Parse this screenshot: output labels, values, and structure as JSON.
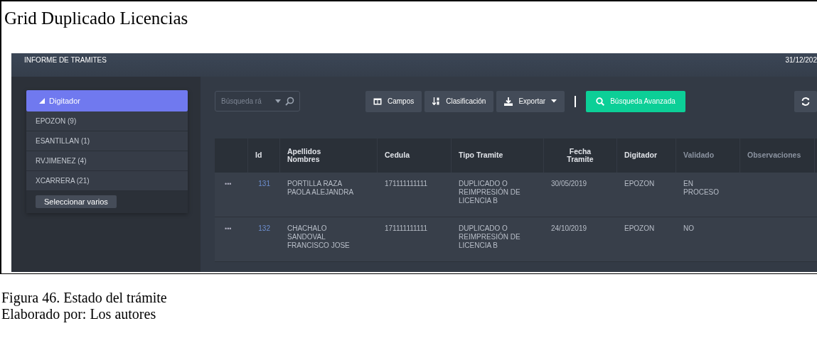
{
  "document": {
    "title": "Grid Duplicado Licencias",
    "caption": "Figura 46. Estado del trámite",
    "credit": "Elaborado por: Los autores"
  },
  "app": {
    "header": {
      "title": "INFORME DE TRAMITES",
      "date": "31/12/202"
    },
    "sidebar": {
      "group": {
        "label": "Digitador",
        "expanded": true
      },
      "items": [
        {
          "label": "EPOZON (9)"
        },
        {
          "label": "ESANTILLAN (1)"
        },
        {
          "label": "RVJIMENEZ (4)"
        },
        {
          "label": "XCARRERA (21)"
        }
      ],
      "button": "Seleccionar varios"
    },
    "toolbar": {
      "search": {
        "placeholder": "Búsqueda rá"
      },
      "buttons": [
        {
          "kind": "columns",
          "label": "Campos"
        },
        {
          "kind": "sort",
          "label": "Clasificación"
        },
        {
          "kind": "export",
          "label": "Exportar"
        },
        {
          "kind": "advanced",
          "label": "Búsqueda Avanzada"
        },
        {
          "kind": "refresh"
        }
      ]
    },
    "table": {
      "columns": [
        {
          "label": "Id",
          "muted": false
        },
        {
          "label": "Apellidos\nNombres",
          "muted": false
        },
        {
          "label": "Cedula",
          "muted": false
        },
        {
          "label": "Tipo Tramite",
          "muted": false
        },
        {
          "label": "Fecha\nTramite",
          "muted": false,
          "center": true
        },
        {
          "label": "Digitador",
          "muted": false
        },
        {
          "label": "Validado",
          "muted": true
        },
        {
          "label": "Observaciones",
          "muted": true
        }
      ],
      "rows": [
        {
          "menu": "•••",
          "id": "131",
          "name": "PORTILLA RAZA\nPAOLA ALEJANDRA",
          "cedula": "171111111111",
          "tipo": "DUPLICADO O\nREIMPRESIÓN DE\nLICENCIA B",
          "fecha": "30/05/2019",
          "digitador": "EPOZON",
          "validado": "EN\nPROCESO"
        },
        {
          "menu": "•••",
          "id": "132",
          "name": "CHACHALO\nSANDOVAL\nFRANCISCO JOSE",
          "cedula": "171111111111",
          "tipo": "DUPLICADO O\nREIMPRESIÓN DE\nLICENCIA B",
          "fecha": "24/10/2019",
          "digitador": "EPOZON",
          "validado": "NO"
        }
      ]
    }
  }
}
